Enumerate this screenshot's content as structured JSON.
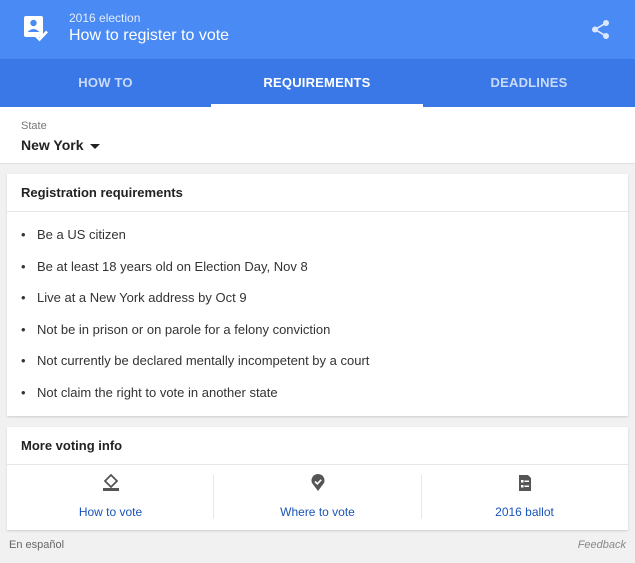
{
  "header": {
    "kicker": "2016 election",
    "title": "How to register to vote",
    "app_icon": "ballot-check-icon",
    "share_icon": "share-icon",
    "background": "#4a8af4"
  },
  "tabs": [
    {
      "label": "HOW TO",
      "active": false
    },
    {
      "label": "REQUIREMENTS",
      "active": true
    },
    {
      "label": "DEADLINES",
      "active": false
    }
  ],
  "state": {
    "label": "State",
    "value": "New York"
  },
  "requirements": {
    "title": "Registration requirements",
    "items": [
      "Be a US citizen",
      "Be at least 18 years old on Election Day, Nov 8",
      "Live at a New York address by Oct 9",
      "Not be in prison or on parole for a felony conviction",
      "Not currently be declared mentally incompetent by a court",
      "Not claim the right to vote in another state"
    ]
  },
  "more_info": {
    "title": "More voting info",
    "links": [
      {
        "label": "How to vote",
        "icon": "ballot-box-icon"
      },
      {
        "label": "Where to vote",
        "icon": "location-pin-icon"
      },
      {
        "label": "2016 ballot",
        "icon": "ballot-document-icon"
      }
    ]
  },
  "footer": {
    "language_link": "En español",
    "feedback_link": "Feedback"
  }
}
